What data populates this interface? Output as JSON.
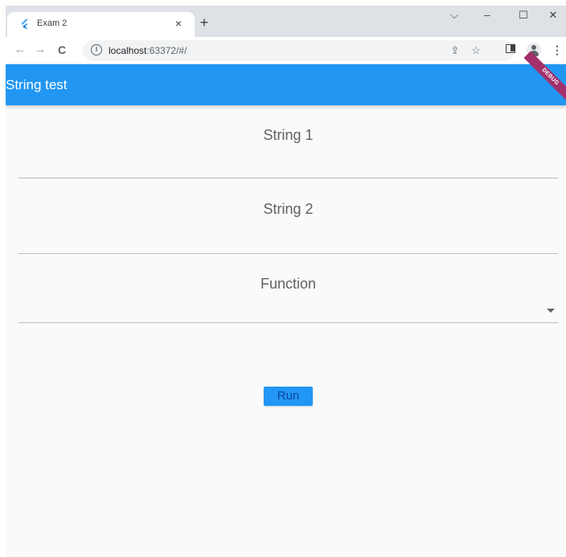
{
  "browser": {
    "tab_title": "Exam 2",
    "tab_close": "×",
    "new_tab": "+",
    "url_host": "localhost",
    "url_rest": ":63372/#/",
    "controls": {
      "dropdown": "⌵",
      "minimize": "–",
      "maximize": "☐",
      "close": "✕"
    },
    "nav": {
      "back": "←",
      "forward": "→",
      "reload": "C"
    },
    "icons": {
      "share": "⇪",
      "star": "☆",
      "menu": "⋮",
      "info": "i"
    }
  },
  "app": {
    "title": "String test",
    "debug_banner": "DEBUG",
    "fields": {
      "string1_label": "String 1",
      "string2_label": "String 2",
      "function_label": "Function"
    },
    "run_label": "Run"
  },
  "colors": {
    "primary": "#2196f3",
    "debug": "#a3306c",
    "background": "#fafafa"
  }
}
